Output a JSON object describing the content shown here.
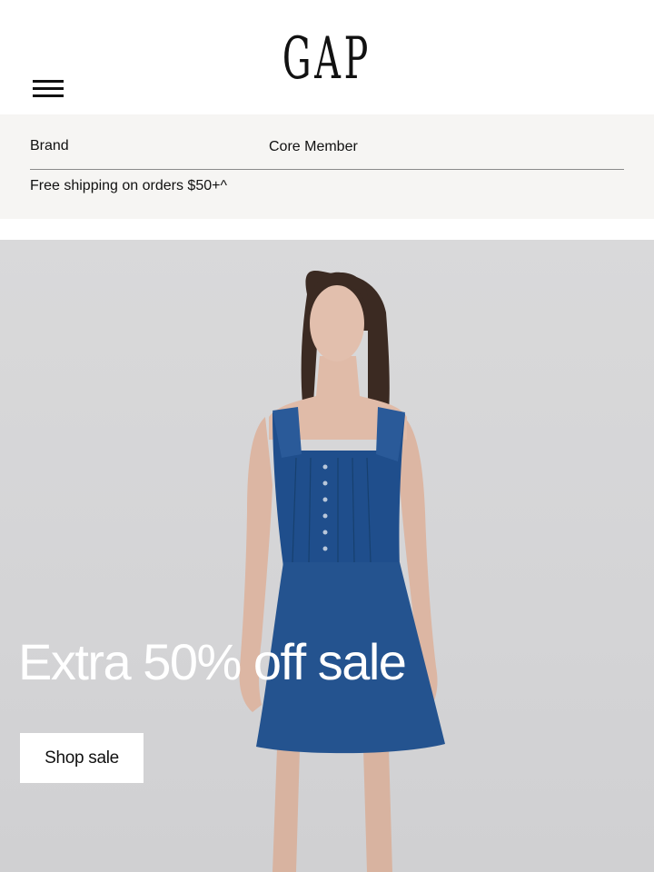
{
  "header": {
    "logo": "GAP",
    "menu_icon": "hamburger-menu-icon"
  },
  "promo_bar": {
    "brand_label": "Brand",
    "member_label": "Core Member",
    "shipping_text": "Free shipping on orders $50+^"
  },
  "hero": {
    "title": "Extra 50% off sale",
    "cta_label": "Shop sale",
    "background_color": "#d6d6d8",
    "dress_color": "#1f4e8c"
  }
}
